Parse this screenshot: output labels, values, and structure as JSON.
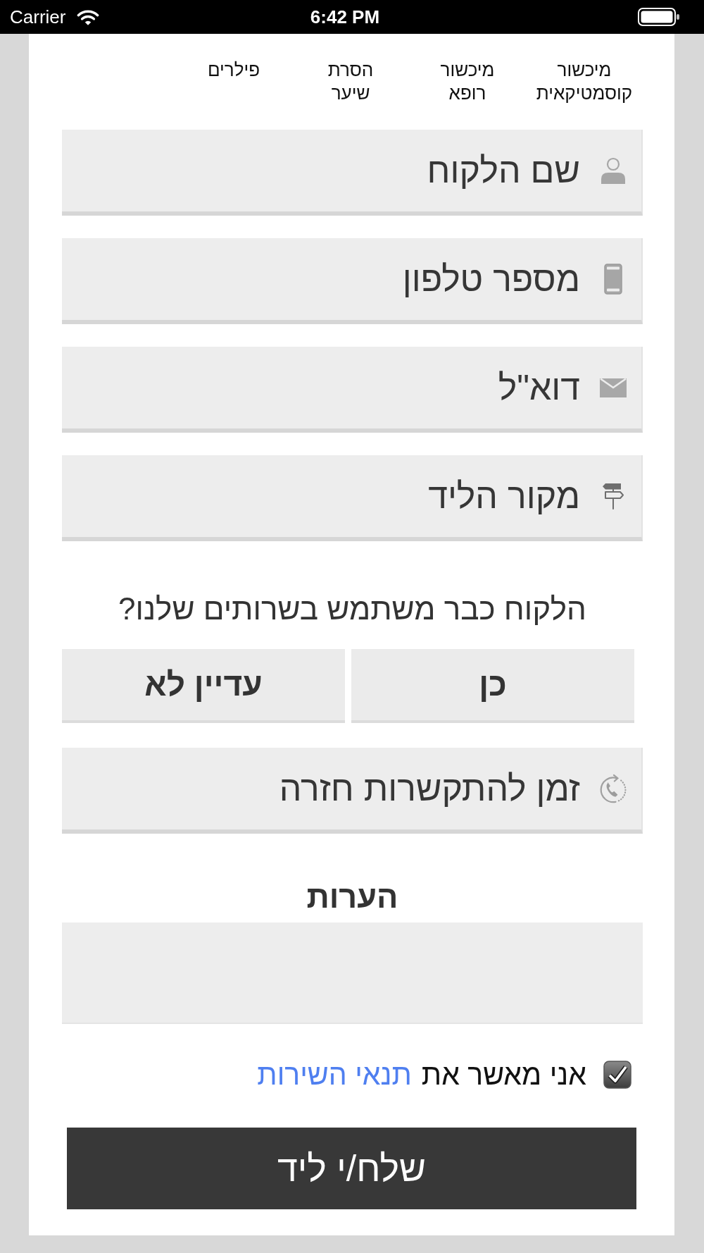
{
  "status_bar": {
    "carrier": "Carrier",
    "time": "6:42 PM"
  },
  "categories": [
    {
      "label": "מיכשור קוסמטיקאית"
    },
    {
      "label": "מיכשור רופא"
    },
    {
      "label": "הסרת שיער"
    },
    {
      "label": "פילרים"
    }
  ],
  "fields": [
    {
      "placeholder": "שם הלקוח"
    },
    {
      "placeholder": "מספר טלפון"
    },
    {
      "placeholder": "דוא\"ל"
    },
    {
      "placeholder": "מקור הליד"
    }
  ],
  "existing_customer": {
    "question": "הלקוח כבר משתמש בשרותים שלנו?",
    "options": [
      {
        "label": "כן",
        "selected": false
      },
      {
        "label": "עדיין לא",
        "selected": false
      }
    ]
  },
  "callback_field": {
    "placeholder": "זמן להתקשרות חזרה"
  },
  "notes": {
    "label": "הערות"
  },
  "terms": {
    "checked": true,
    "text": "אני מאשר את",
    "link": "תנאי השירות"
  },
  "submit": {
    "label": "שלח/י ליד"
  }
}
